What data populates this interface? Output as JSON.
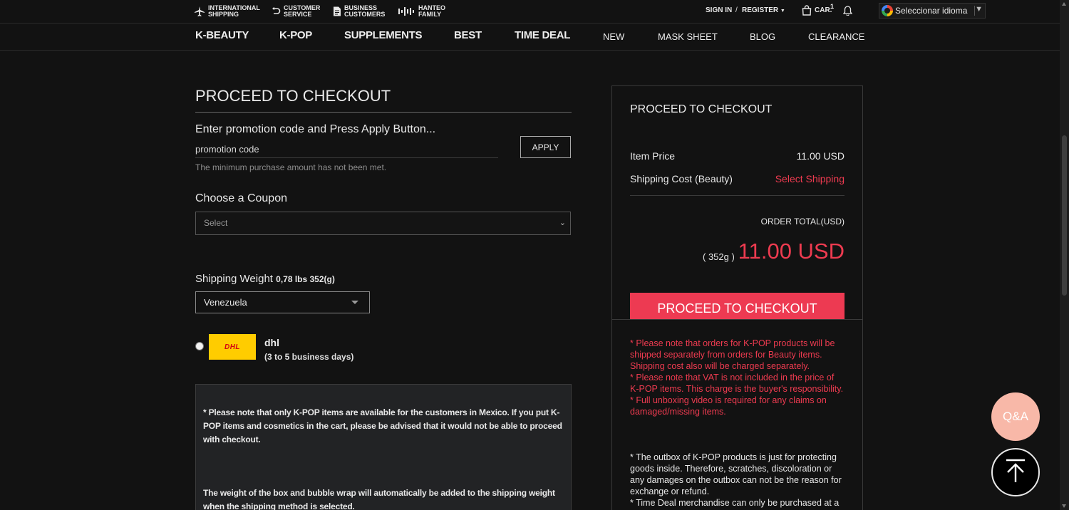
{
  "topbar": {
    "international_shipping": "INTERNATIONAL\nSHIPPING",
    "customer_service": "CUSTOMER\nSERVICE",
    "business_customers": "BUSINESS\nCUSTOMERS",
    "hanteo_family": "HANTEO\nFAMILY",
    "sign_in": "SIGN IN",
    "divider": "/",
    "register": "REGISTER",
    "cart_label": "CAR.",
    "cart_count": "1",
    "language": "Seleccionar idioma",
    "language_arrow": "▼"
  },
  "nav": {
    "items": [
      "K-BEAUTY",
      "K-POP",
      "SUPPLEMENTS",
      "BEST",
      "TIME DEAL",
      "NEW",
      "MASK SHEET",
      "BLOG",
      "CLEARANCE"
    ]
  },
  "checkout": {
    "heading": "PROCEED TO CHECKOUT",
    "promo_title": "Enter promotion code and Press Apply Button...",
    "promo_placeholder": "promotion code",
    "apply_label": "APPLY",
    "min_purchase_msg": "The minimum purchase amount has not been met.",
    "coupon_title": "Choose a Coupon",
    "coupon_selected": "Select",
    "shipping_weight_label": "Shipping Weight",
    "shipping_weight_value": "0,78 lbs 352(g)",
    "country_selected": "Venezuela",
    "carrier_logo_text": "DHL",
    "carrier_name": "dhl",
    "carrier_days": "(3 to 5 business days)",
    "note_1": "* Please note that only K-POP items are available for the customers in Mexico. If you put K-POP items and cosmetics in the cart, please be advised that it would not be able to proceed with checkout.",
    "note_2": "The weight of the box and bubble wrap will automatically be added to the shipping weight when the shipping method is selected."
  },
  "summary": {
    "title": "PROCEED TO CHECKOUT",
    "item_price_label": "Item Price",
    "item_price_value": "11.00 USD",
    "shipping_label": "Shipping Cost (Beauty)",
    "shipping_value": "Select Shipping",
    "order_total_label": "ORDER TOTAL(USD)",
    "weight": "( 352g )",
    "total": "11.00 USD",
    "checkout_button": "PROCEED TO CHECKOUT",
    "red_notes": "* Please note that orders for K-POP products will be shipped separately from orders for Beauty items. Shipping cost also will be charged separately.\n* Please note that VAT is not included in the price of K-POP items. This charge is the buyer's responsibility.\n* Full unboxing video is required for any claims on damaged/missing items.",
    "white_notes": "* The outbox of K-POP products is just for protecting goods inside. Therefore, scratches, discoloration or any damages on the outbox can not be the reason for exchange or refund.\n* Time Deal merchandise can only be purchased at a"
  },
  "floating": {
    "qa_label": "Q&A"
  },
  "colors": {
    "accent_red": "#ed3a52",
    "qa_pink": "#f8b8a8",
    "background": "#121212"
  },
  "icons": [
    "airplane-icon",
    "return-icon",
    "document-icon",
    "hanteo-icon",
    "bag-icon",
    "bell-icon",
    "google-icon",
    "arrow-up-icon"
  ]
}
